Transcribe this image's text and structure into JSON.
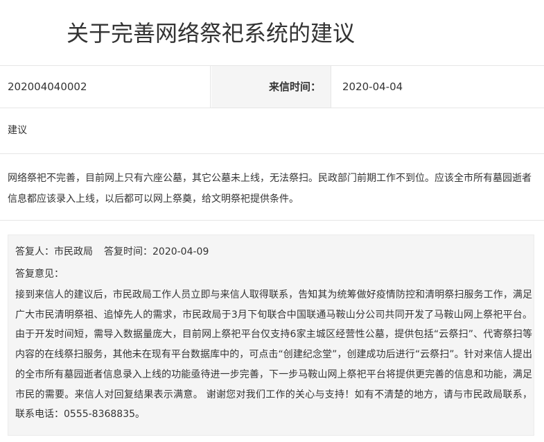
{
  "title": "关于完善网络祭祀系统的建议",
  "meta": {
    "id": "202004040002",
    "date_label": "来信时间：",
    "date_value": "2020-04-04"
  },
  "category": "建议",
  "content": "网络祭祀不完善，目前网上只有六座公墓，其它公墓未上线，无法祭扫。民政部门前期工作不到位。应该全市所有墓园逝者信息都应该录入上线，以后都可以网上祭奠，给文明祭祀提供条件。",
  "reply": {
    "responder": "答复人：市民政局",
    "time": "答复时间：2020-04-09",
    "opinion_label": "答复意见：",
    "body": "接到来信人的建议后，市民政局工作人员立即与来信人取得联系，告知其为统筹做好疫情防控和清明祭扫服务工作，满足广大市民清明祭祖、追悼先人的需求，市民政局于3月下旬联合中国联通马鞍山分公司共同开发了马鞍山网上祭祀平台。由于开发时间短，需导入数据量庞大，目前网上祭祀平台仅支持6家主城区经营性公墓，提供包括“云祭扫”、代寄祭扫等内容的在线祭扫服务，其他未在现有平台数据库中的，可点击“创建纪念堂”，创建成功后进行“云祭扫”。针对来信人提出的全市所有墓园逝者信息录入上线的功能亟待进一步完善，下一步马鞍山网上祭祀平台将提供更完善的信息和功能，满足市民的需要。来信人对回复结果表示满意。 谢谢您对我们工作的关心与支持！如有不清楚的地方，请与市民政局联系，联系电话：0555-8368835。"
  }
}
